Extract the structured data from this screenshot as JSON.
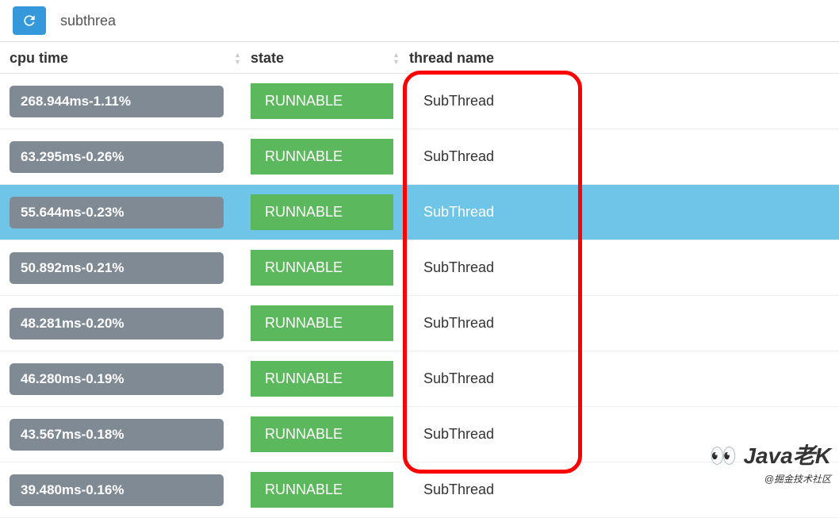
{
  "toolbar": {
    "search_value": "subthrea"
  },
  "headers": {
    "cpu": "cpu time",
    "state": "state",
    "thread": "thread name"
  },
  "rows": [
    {
      "cpu": "268.944ms-1.11%",
      "state": "RUNNABLE",
      "thread": "SubThread",
      "selected": false
    },
    {
      "cpu": "63.295ms-0.26%",
      "state": "RUNNABLE",
      "thread": "SubThread",
      "selected": false
    },
    {
      "cpu": "55.644ms-0.23%",
      "state": "RUNNABLE",
      "thread": "SubThread",
      "selected": true
    },
    {
      "cpu": "50.892ms-0.21%",
      "state": "RUNNABLE",
      "thread": "SubThread",
      "selected": false
    },
    {
      "cpu": "48.281ms-0.20%",
      "state": "RUNNABLE",
      "thread": "SubThread",
      "selected": false
    },
    {
      "cpu": "46.280ms-0.19%",
      "state": "RUNNABLE",
      "thread": "SubThread",
      "selected": false
    },
    {
      "cpu": "43.567ms-0.18%",
      "state": "RUNNABLE",
      "thread": "SubThread",
      "selected": false
    },
    {
      "cpu": "39.480ms-0.16%",
      "state": "RUNNABLE",
      "thread": "SubThread",
      "selected": false
    }
  ],
  "watermark": {
    "line1": "Java老K",
    "line2": "@掘金技术社区"
  }
}
